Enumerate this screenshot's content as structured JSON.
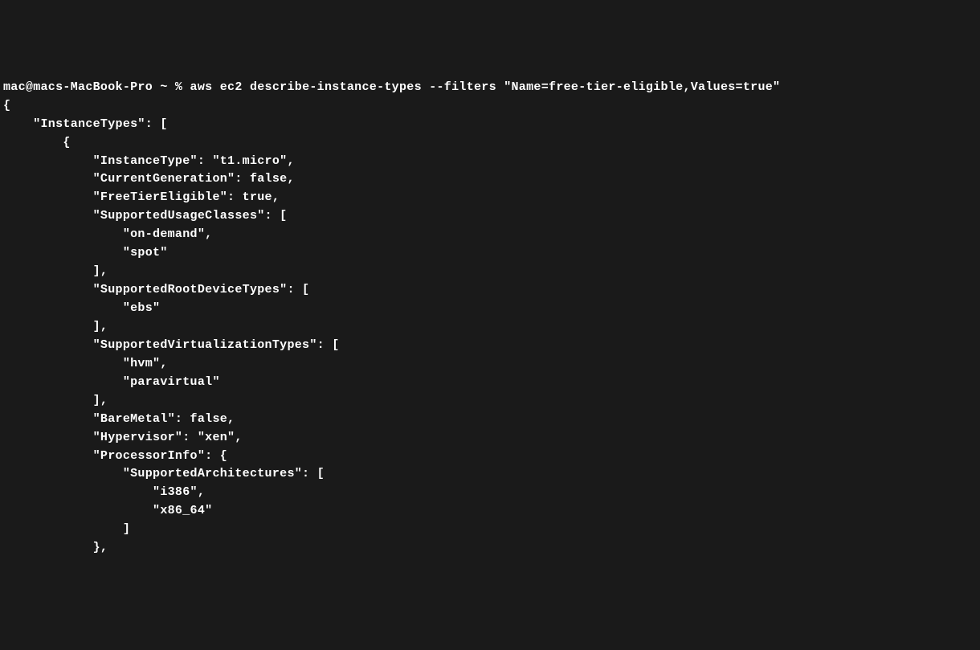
{
  "terminal": {
    "prompt": "mac@macs-MacBook-Pro ~ % ",
    "command": "aws ec2 describe-instance-types --filters \"Name=free-tier-eligible,Values=true\"",
    "output_lines": [
      "",
      "{",
      "    \"InstanceTypes\": [",
      "        {",
      "            \"InstanceType\": \"t1.micro\",",
      "            \"CurrentGeneration\": false,",
      "            \"FreeTierEligible\": true,",
      "            \"SupportedUsageClasses\": [",
      "                \"on-demand\",",
      "                \"spot\"",
      "            ],",
      "            \"SupportedRootDeviceTypes\": [",
      "                \"ebs\"",
      "            ],",
      "            \"SupportedVirtualizationTypes\": [",
      "                \"hvm\",",
      "                \"paravirtual\"",
      "            ],",
      "            \"BareMetal\": false,",
      "            \"Hypervisor\": \"xen\",",
      "            \"ProcessorInfo\": {",
      "                \"SupportedArchitectures\": [",
      "                    \"i386\",",
      "                    \"x86_64\"",
      "                ]",
      "            },"
    ]
  }
}
